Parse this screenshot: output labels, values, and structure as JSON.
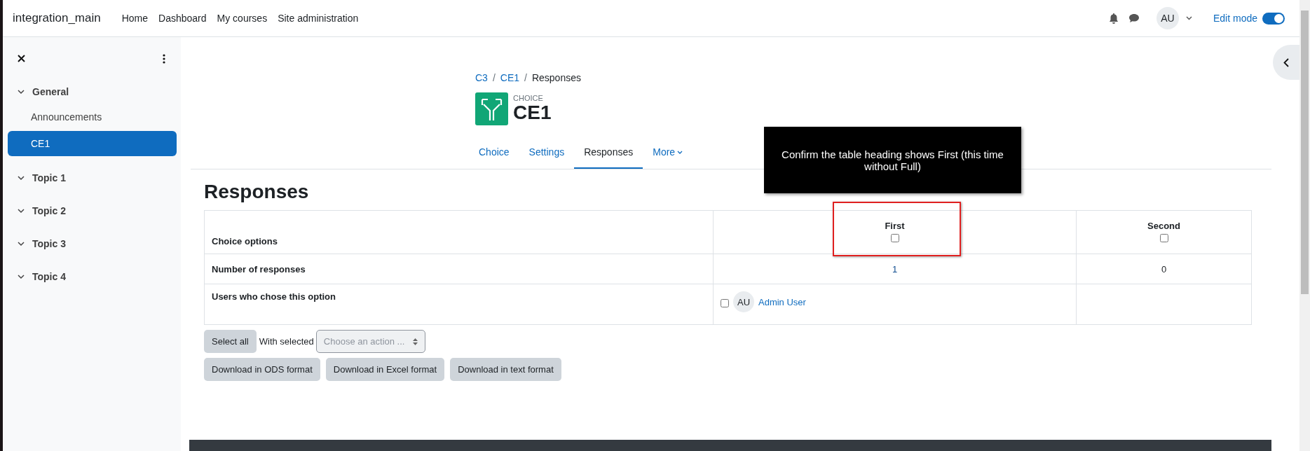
{
  "navbar": {
    "brand": "integration_main",
    "links": [
      "Home",
      "Dashboard",
      "My courses",
      "Site administration"
    ],
    "avatar": "AU",
    "edit_mode": {
      "label": "Edit mode",
      "on": true
    }
  },
  "sidebar": {
    "items": [
      {
        "label": "General",
        "expanded": true,
        "children": [
          {
            "label": "Announcements",
            "selected": false
          },
          {
            "label": "CE1",
            "selected": true
          }
        ]
      },
      {
        "label": "Topic 1",
        "expanded": true
      },
      {
        "label": "Topic 2",
        "expanded": true
      },
      {
        "label": "Topic 3",
        "expanded": true
      },
      {
        "label": "Topic 4",
        "expanded": true
      }
    ]
  },
  "breadcrumb": [
    {
      "kind": "link",
      "label": "C3"
    },
    {
      "kind": "separator",
      "label": "/"
    },
    {
      "kind": "link",
      "label": "CE1"
    },
    {
      "kind": "separator",
      "label": "/"
    },
    {
      "kind": "current",
      "label": "Responses"
    }
  ],
  "activity": {
    "type": "CHOICE",
    "title": "CE1"
  },
  "tabs": [
    {
      "label": "Choice",
      "selected": false,
      "dropdown": false
    },
    {
      "label": "Settings",
      "selected": false,
      "dropdown": false
    },
    {
      "label": "Responses",
      "selected": true,
      "dropdown": false
    },
    {
      "label": "More",
      "selected": false,
      "dropdown": true
    }
  ],
  "heading": "Responses",
  "table": {
    "options_label": "Choice options",
    "options": [
      {
        "name": "First",
        "checked": false
      },
      {
        "name": "Second",
        "checked": false
      }
    ],
    "count_label": "Number of responses",
    "counts": [
      {
        "value": "1",
        "link": true
      },
      {
        "value": "0",
        "link": false
      }
    ],
    "users_label": "Users who chose this option",
    "users": [
      [
        {
          "initials": "AU",
          "name": "Admin User",
          "checked": false
        }
      ]
    ]
  },
  "actions": {
    "select_all": "Select all",
    "with_selected": "With selected",
    "select_placeholder": "Choose an action ...",
    "downloads": [
      "Download in ODS format",
      "Download in Excel format",
      "Download in text format"
    ]
  },
  "tooltip": "Confirm the table heading shows First (this time without Full)"
}
